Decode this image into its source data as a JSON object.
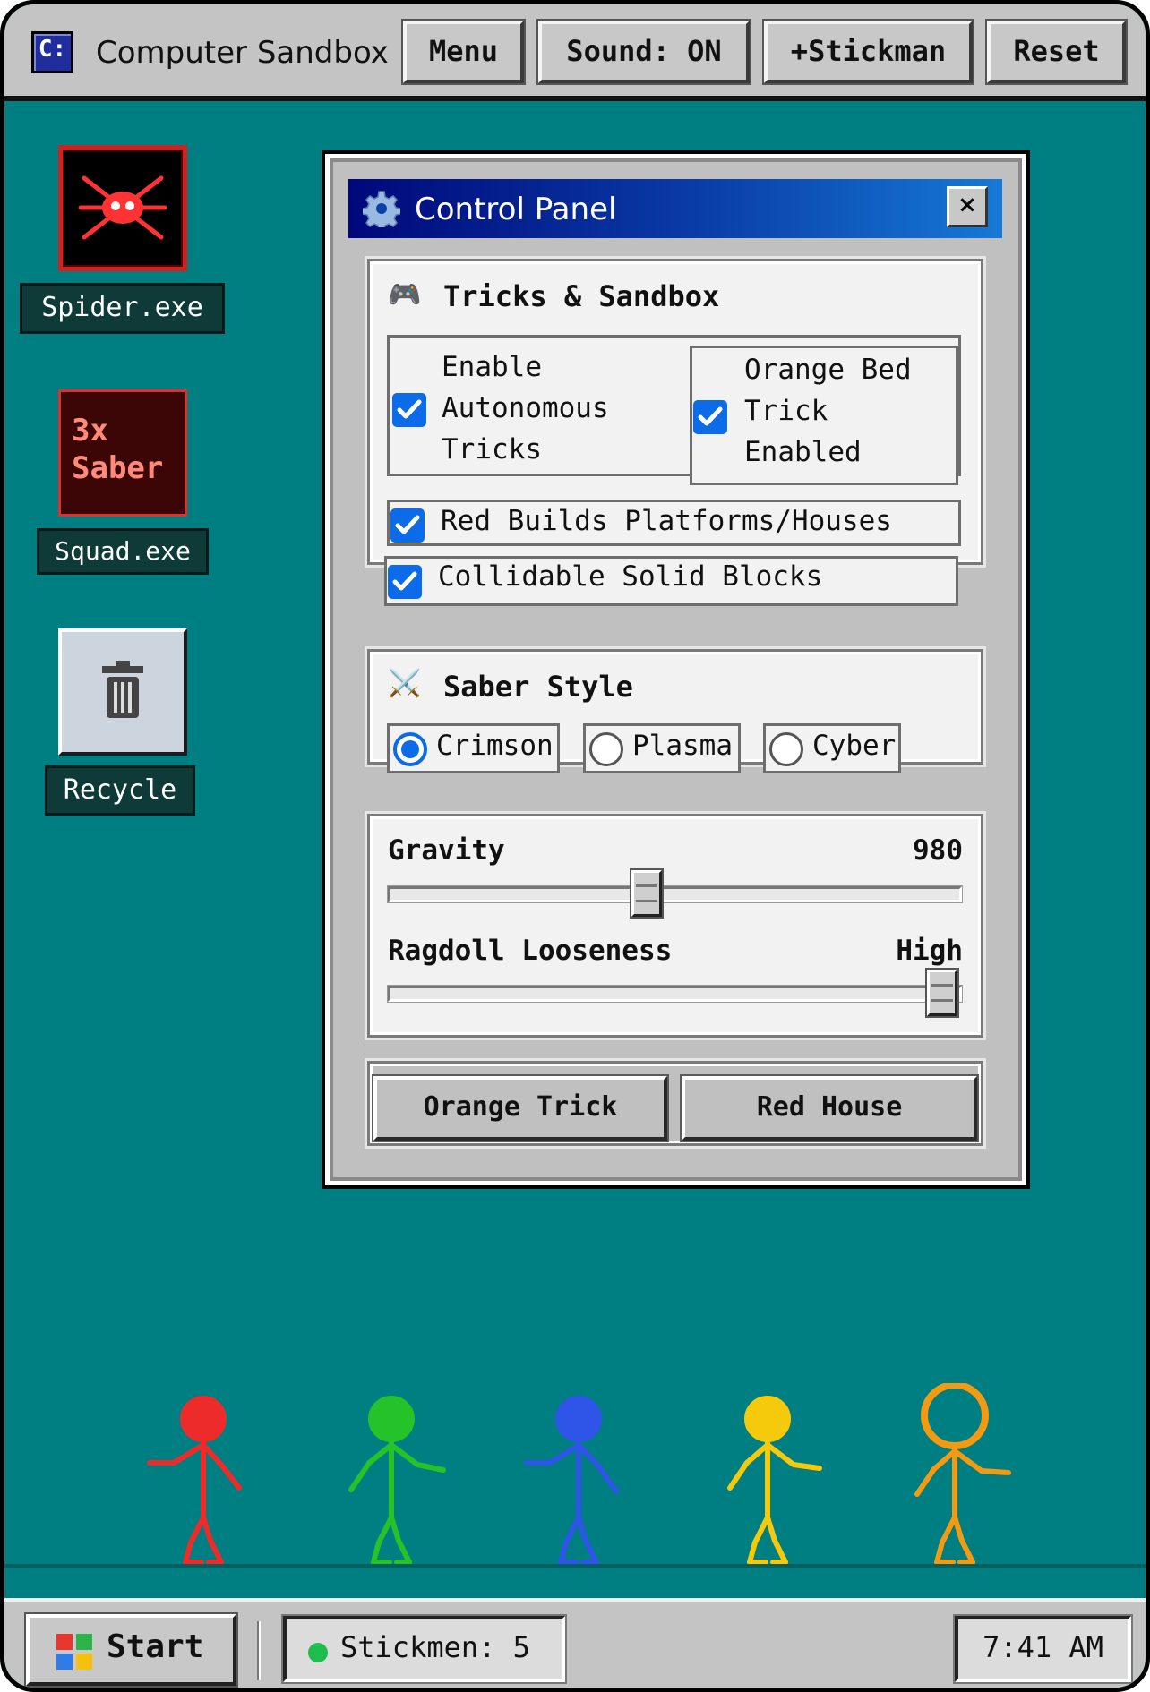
{
  "app": {
    "icon_text": "C:",
    "title": "Computer Sandbox"
  },
  "toolbar": {
    "menu_label": "Menu",
    "sound_label": "Sound: ON",
    "add_stickman_label": "+Stickman",
    "reset_label": "Reset"
  },
  "desktop": {
    "spider": {
      "label": "Spider.exe",
      "icon": "spider-icon"
    },
    "squad": {
      "tile_line1": "3x",
      "tile_line2": "Saber",
      "label": "Squad.exe"
    },
    "recycle": {
      "label": "Recycle",
      "icon": "trash-icon"
    }
  },
  "control_panel": {
    "title": "Control Panel",
    "close_label": "×",
    "tricks_group": {
      "title": "Tricks & Sandbox",
      "icon": "gamepad-icon",
      "options": [
        {
          "lines": [
            "Enable",
            "Autonomous",
            "Tricks"
          ],
          "checked": true
        },
        {
          "lines": [
            "Orange Bed",
            "Trick",
            "Enabled"
          ],
          "checked": true
        },
        {
          "label": "Red Builds Platforms/Houses",
          "checked": true
        },
        {
          "label": "Collidable Solid Blocks",
          "checked": true
        }
      ]
    },
    "saber_group": {
      "title": "Saber Style",
      "icon": "crossed-swords-icon",
      "options": [
        {
          "label": "Crimson",
          "selected": true
        },
        {
          "label": "Plasma",
          "selected": false
        },
        {
          "label": "Cyber",
          "selected": false
        }
      ]
    },
    "physics_group": {
      "gravity": {
        "label": "Gravity",
        "value": "980",
        "fraction": 0.45
      },
      "ragdoll": {
        "label": "Ragdoll Looseness",
        "value": "High",
        "fraction": 1.0
      }
    },
    "actions": {
      "orange_trick_label": "Orange Trick",
      "red_house_label": "Red House"
    }
  },
  "stickmen": [
    {
      "color": "#ee2b2b"
    },
    {
      "color": "#26c22a"
    },
    {
      "color": "#2f55e8"
    },
    {
      "color": "#f5c90c"
    },
    {
      "color": "#f29a12"
    }
  ],
  "taskbar": {
    "start_label": "Start",
    "stickmen_count": "Stickmen: 5",
    "status_color": "#1fbd4e",
    "clock": "7:41 AM"
  },
  "colors": {
    "desktop": "#007f82",
    "accent": "#0b6be8"
  }
}
